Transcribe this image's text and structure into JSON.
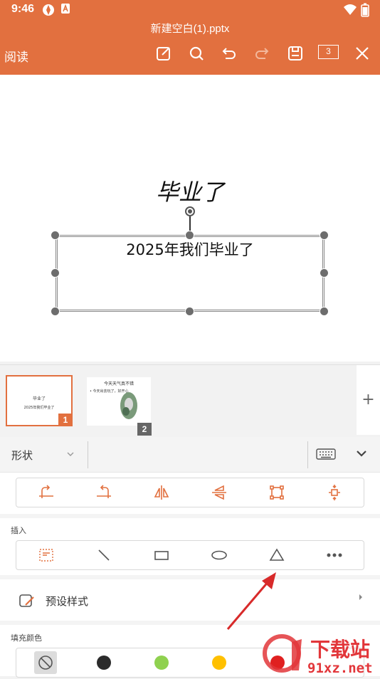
{
  "status_bar": {
    "time": "9:46"
  },
  "title_bar": {
    "document_title": "新建空白(1).pptx",
    "read_label": "阅读",
    "page_count": "3"
  },
  "slide": {
    "title": "毕业了",
    "selected_text": "2025年我们毕业了"
  },
  "thumbnails": [
    {
      "number": "1",
      "title": "毕业了",
      "subtitle": "2025年我们毕业了"
    },
    {
      "number": "2",
      "title": "今天天气真不错",
      "subtitle": "• 今天出去玩了，好开心"
    }
  ],
  "add_slide_label": "+",
  "panel": {
    "shape_label": "形状",
    "insert_label": "插入",
    "preset_style_label": "预设样式",
    "fill_color_label": "填充颜色",
    "fill_colors": [
      "none",
      "#2b2b2b",
      "#8fd14f",
      "#ffc000",
      "#e02020"
    ]
  },
  "watermark": {
    "brand": "下载站",
    "site": "91xz.net"
  },
  "colors": {
    "accent": "#e2703f",
    "arrow": "#d82a2a"
  }
}
